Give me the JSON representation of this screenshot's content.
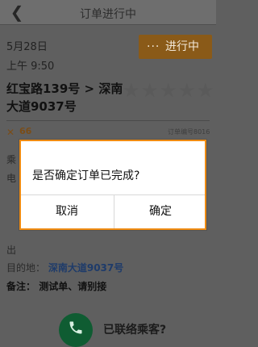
{
  "header": {
    "back_icon": "chevron-left-icon",
    "title": "订单进行中"
  },
  "trip": {
    "date": "5月28日",
    "time": "上午 9:50",
    "status_dots": "···",
    "status_label": "进行中",
    "route": "红宝路139号 > 深南大道9037号",
    "rating_stars": 5
  },
  "order": {
    "price": "66",
    "order_no_partial": "订单编号8016"
  },
  "hidden_rows": {
    "hint_a": "乘",
    "hint_b": "电"
  },
  "address": {
    "start_label": "出",
    "dest_label": "目的地：",
    "dest_value": "深南大道9037号",
    "remark_label": "备注：",
    "remark_value": "测试单、请别接"
  },
  "contact": {
    "question": "已联络乘客?",
    "phone_icon": "phone-icon"
  },
  "dialog": {
    "message": "是否确定订单已完成?",
    "cancel_label": "取消",
    "confirm_label": "确定"
  }
}
